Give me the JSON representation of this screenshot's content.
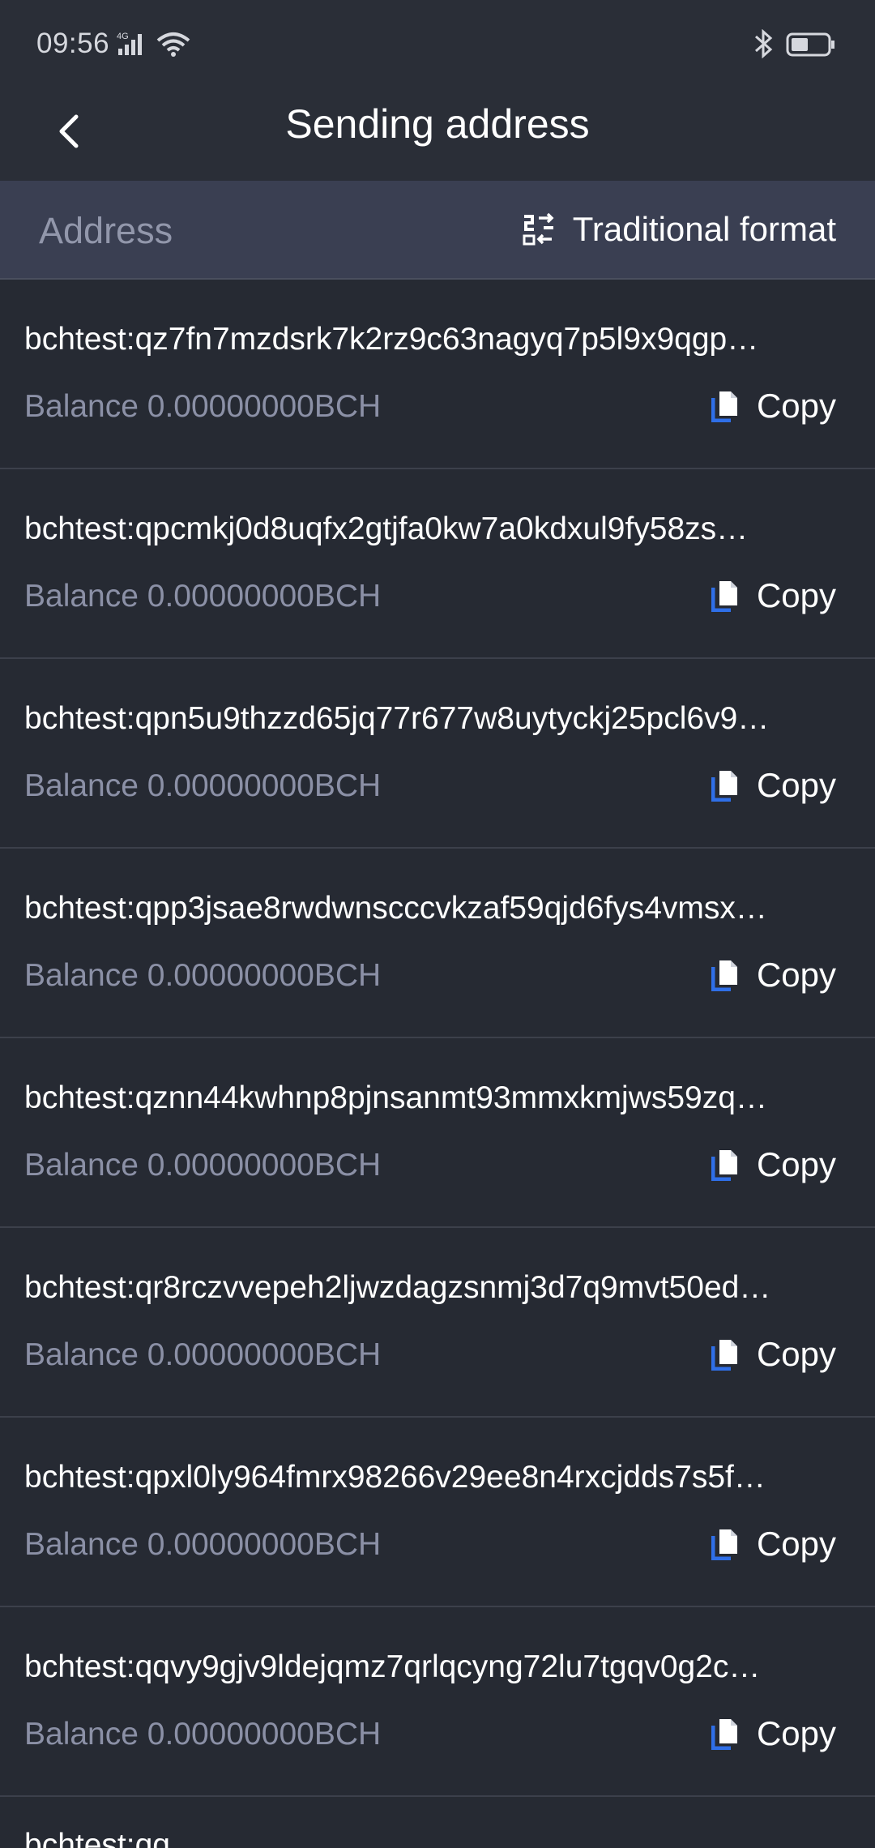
{
  "status_bar": {
    "time": "09:56",
    "network": "4G",
    "icons": [
      "signal-icon",
      "wifi-icon",
      "bluetooth-icon",
      "battery-icon"
    ]
  },
  "header": {
    "title": "Sending address",
    "back_icon": "chevron-left-icon"
  },
  "subheader": {
    "address_label": "Address",
    "format_label": "Traditional format",
    "format_icon": "swap-format-icon"
  },
  "copy_label": "Copy",
  "addresses": [
    {
      "address": "bchtest:qz7fn7mzdsrk7k2rz9c63nagyq7p5l9x9qgp…",
      "balance": "Balance 0.00000000BCH"
    },
    {
      "address": "bchtest:qpcmkj0d8uqfx2gtjfa0kw7a0kdxul9fy58zs…",
      "balance": "Balance 0.00000000BCH"
    },
    {
      "address": "bchtest:qpn5u9thzzd65jq77r677w8uytyckj25pcl6v9…",
      "balance": "Balance 0.00000000BCH"
    },
    {
      "address": "bchtest:qpp3jsae8rwdwnscccvkzaf59qjd6fys4vmsx…",
      "balance": "Balance 0.00000000BCH"
    },
    {
      "address": "bchtest:qznn44kwhnp8pjnsanmt93mmxkmjws59zq…",
      "balance": "Balance 0.00000000BCH"
    },
    {
      "address": "bchtest:qr8rczvvepeh2ljwzdagzsnmj3d7q9mvt50ed…",
      "balance": "Balance 0.00000000BCH"
    },
    {
      "address": "bchtest:qpxl0ly964fmrx98266v29ee8n4rxcjdds7s5f…",
      "balance": "Balance 0.00000000BCH"
    },
    {
      "address": "bchtest:qqvy9gjv9ldejqmz7qrlqcyng72lu7tgqv0g2c…",
      "balance": "Balance 0.00000000BCH"
    }
  ],
  "partial_row": {
    "address": "bchtest:qq…"
  },
  "colors": {
    "background": "#262a33",
    "subheader_bg": "#3a3f52",
    "muted_text": "#8b90a6",
    "copy_icon_accent": "#2f6fe8"
  }
}
